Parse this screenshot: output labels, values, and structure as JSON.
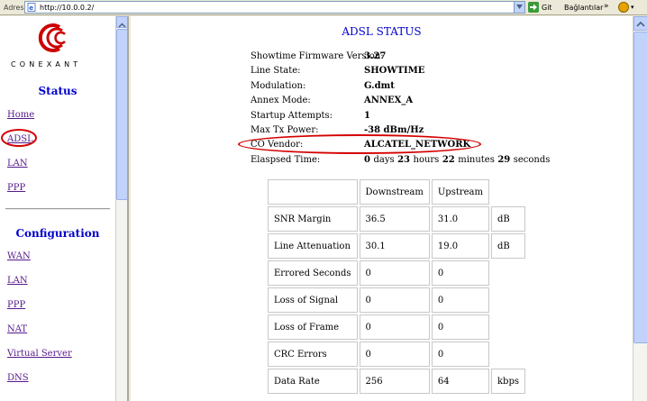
{
  "browser": {
    "address_label": "Adres",
    "url": "http://10.0.0.2/",
    "go_label": "Git",
    "links_label": "Bağlantılar",
    "links_chevron": "»"
  },
  "sidebar": {
    "logo_text": "CONEXANT",
    "status_title": "Status",
    "status_links": [
      "Home",
      "ADSL",
      "LAN",
      "PPP"
    ],
    "config_title": "Configuration",
    "config_links": [
      "WAN",
      "LAN",
      "PPP",
      "NAT",
      "Virtual Server",
      "DNS"
    ]
  },
  "main": {
    "title": "ADSL STATUS",
    "status": [
      {
        "label": "Showtime Firmware Version:",
        "value": "3.27"
      },
      {
        "label": "Line State:",
        "value": "SHOWTIME"
      },
      {
        "label": "Modulation:",
        "value": "G.dmt"
      },
      {
        "label": "Annex Mode:",
        "value": "ANNEX_A"
      },
      {
        "label": "Startup Attempts:",
        "value": "1"
      },
      {
        "label": "Max Tx Power:",
        "value": "-38 dBm/Hz"
      },
      {
        "label": "CO Vendor:",
        "value": "ALCATEL_NETWORK"
      }
    ],
    "elapsed": {
      "label": "Elaspsed Time:",
      "days": "0",
      "days_unit": "days",
      "hours": "23",
      "hours_unit": "hours",
      "minutes": "22",
      "minutes_unit": "minutes",
      "seconds": "29",
      "seconds_unit": "seconds"
    },
    "stats": {
      "headers": [
        "",
        "Downstream",
        "Upstream",
        ""
      ],
      "rows": [
        {
          "name": "SNR Margin",
          "down": "36.5",
          "up": "31.0",
          "unit": "dB"
        },
        {
          "name": "Line Attenuation",
          "down": "30.1",
          "up": "19.0",
          "unit": "dB"
        },
        {
          "name": "Errored Seconds",
          "down": "0",
          "up": "0",
          "unit": ""
        },
        {
          "name": "Loss of Signal",
          "down": "0",
          "up": "0",
          "unit": ""
        },
        {
          "name": "Loss of Frame",
          "down": "0",
          "up": "0",
          "unit": ""
        },
        {
          "name": "CRC Errors",
          "down": "0",
          "up": "0",
          "unit": ""
        },
        {
          "name": "Data Rate",
          "down": "256",
          "up": "64",
          "unit": "kbps"
        }
      ]
    }
  },
  "colors": {
    "link": "#551a8b",
    "heading": "#0000cc",
    "annotation": "#d40000"
  }
}
